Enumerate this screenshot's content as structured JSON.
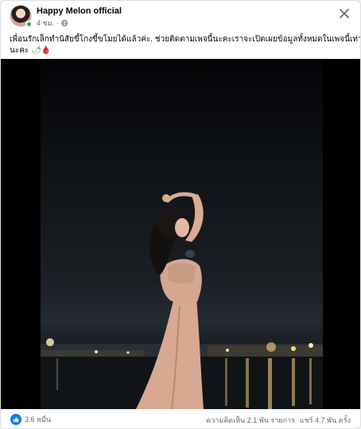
{
  "post": {
    "author": "Happy Melon official",
    "time": "4 ชม.",
    "separator": "·",
    "caption_line1": "เพื่อนรักเล็กทำนิสัยขี้โกงขี้ขโมยได้แล้วค่ะ. ช่วยติดตามเพจนี้นะคะเราจะเปิดเผยข้อมูลทั้งหมดในเพจนี้เท่านั้น",
    "caption_line2": "นะคะ",
    "caption_emoji_1": "🌶",
    "caption_emoji_2": "🩸"
  },
  "footer": {
    "reactions_count": "3.6 หมื่น",
    "comments": "ความคิดเห็น 2.1 พัน รายการ",
    "shares": "แชร์ 4.7 พัน ครั้ง"
  },
  "colors": {
    "facebook_blue": "#1877f2",
    "online_green": "#31a24c",
    "secondary_text": "#65676b",
    "dress_pink": "#d8a892"
  },
  "icons": {
    "close": "close-icon",
    "globe": "globe-icon",
    "like": "like-icon"
  }
}
